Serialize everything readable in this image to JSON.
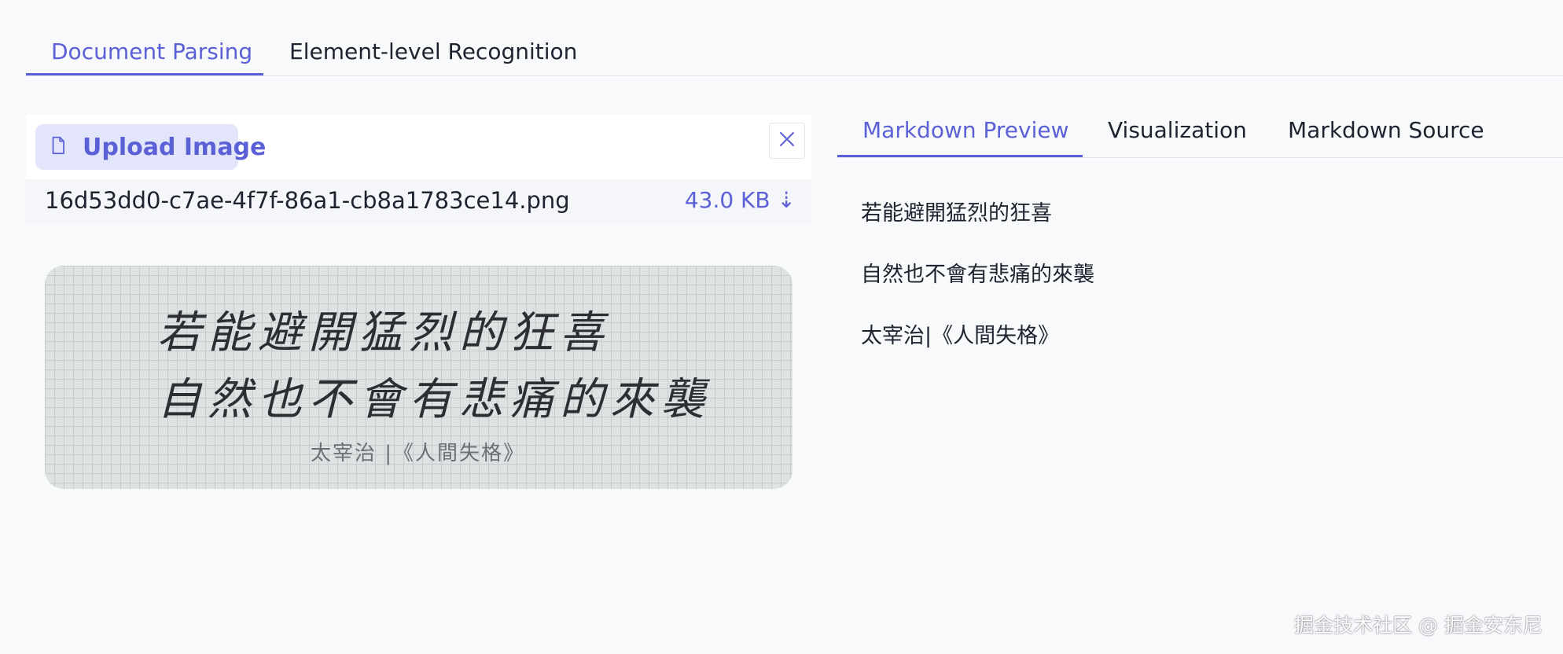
{
  "top_tabs": [
    {
      "label": "Document Parsing",
      "active": true
    },
    {
      "label": "Element-level Recognition",
      "active": false
    }
  ],
  "upload": {
    "button_label": "Upload Image",
    "file_icon": "file-icon",
    "close_icon": "close-icon"
  },
  "file": {
    "name": "16d53dd0-c7ae-4f7f-86a1-cb8a1783ce14.png",
    "size": "43.0 KB ⇣"
  },
  "image_preview": {
    "line1": "若能避開猛烈的狂喜",
    "line2": "自然也不會有悲痛的來襲",
    "caption": "太宰治 |《人間失格》"
  },
  "right_tabs": [
    {
      "label": "Markdown Preview",
      "active": true
    },
    {
      "label": "Visualization",
      "active": false
    },
    {
      "label": "Markdown Source",
      "active": false
    }
  ],
  "markdown": {
    "paragraphs": [
      "若能避開猛烈的狂喜",
      "自然也不會有悲痛的來襲",
      "太宰治|《人間失格》"
    ]
  },
  "watermark": "掘金技术社区 @ 掘金安东尼",
  "colors": {
    "accent": "#5b60d6",
    "upload_button_bg": "#e3e6fb",
    "page_bg": "#f8f9fb"
  }
}
